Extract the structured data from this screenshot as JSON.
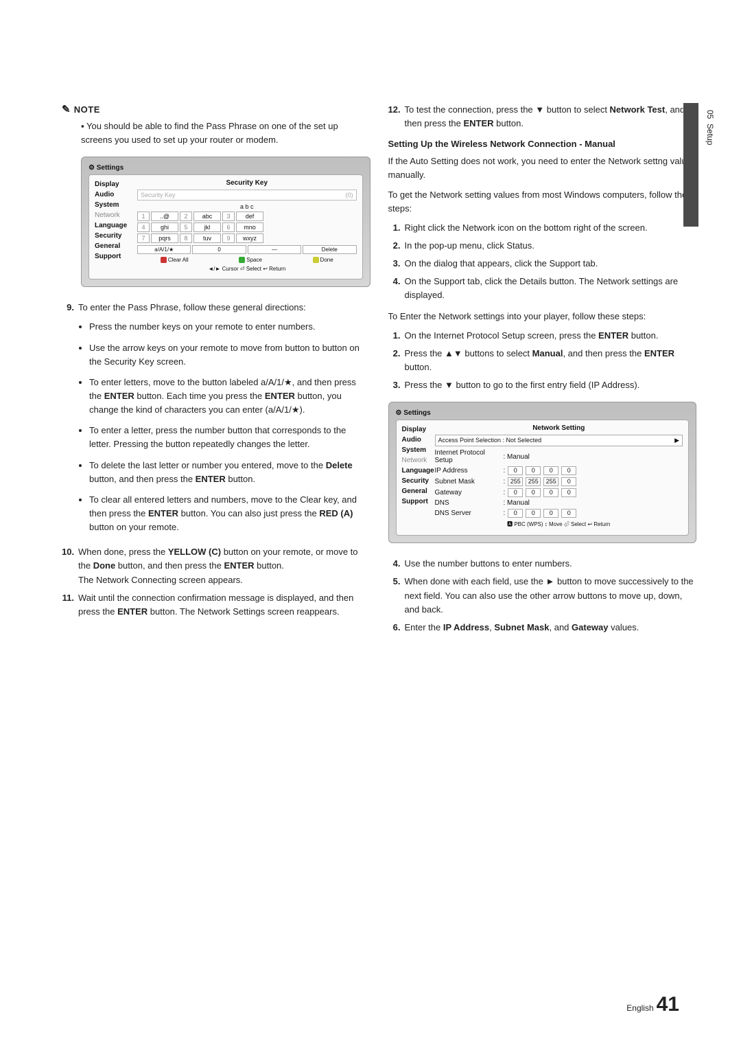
{
  "sideTab": {
    "chapter": "05",
    "title": "Setup"
  },
  "footer": {
    "lang": "English",
    "page": "41"
  },
  "left": {
    "noteLabel": "NOTE",
    "noteText": "You should be able to find the Pass Phrase on one of the set up screens you used to set up your router or modem.",
    "step9n": "9.",
    "step9": "To enter the Pass Phrase, follow these general directions:",
    "b1": "Press the number keys on your remote to enter numbers.",
    "b2": "Use the arrow keys on your remote to move from button to button on the Security Key screen.",
    "b3a": "To enter letters, move to the button labeled a/A/1/★, and then press the ",
    "b3b": " button. Each time you press the ",
    "b3c": " button, you change the kind of characters you can enter (a/A/1/★).",
    "b4": "To enter a letter, press the number button that corresponds to the letter. Pressing the button repeatedly changes the letter.",
    "b5a": "To delete the last letter or number you entered, move to the ",
    "b5b": " button, and then press the ",
    "b5c": " button.",
    "b6a": "To clear all entered letters and numbers, move to the Clear key, and then press the ",
    "b6b": " button. You can also just press the ",
    "b6c": " button on your remote.",
    "step10n": "10.",
    "step10a": "When done, press the ",
    "step10b": " button on your remote, or move to the ",
    "step10c": " button, and then press the ",
    "step10d": " button.",
    "step10e": "The Network Connecting screen appears.",
    "step11n": "11.",
    "step11a": "Wait until the connection confirmation message is displayed, and then press the ",
    "step11b": " button. The Network Settings screen reappears.",
    "enter": "ENTER",
    "delete": "Delete",
    "yellowc": "YELLOW (C)",
    "done": "Done",
    "reda": "RED (A)"
  },
  "right": {
    "step12n": "12.",
    "step12a": "To test the connection, press the ▼ button to select ",
    "step12nt": "Network Test",
    "step12b": ", and then press the ",
    "step12c": " button.",
    "heading": "Setting Up the Wireless Network Connection - Manual",
    "p1": "If the Auto Setting does not work, you need to enter the Network settng values manually.",
    "p2": "To get the Network setting values from most Windows computers, follow these steps:",
    "a1n": "1.",
    "a1": "Right click the Network icon on the bottom right of the screen.",
    "a2n": "2.",
    "a2": "In the pop-up menu, click Status.",
    "a3n": "3.",
    "a3": "On the dialog that appears, click the Support tab.",
    "a4n": "4.",
    "a4": "On the Support tab, click the Details button. The Network settings are displayed.",
    "p3": "To Enter the Network settings into your player, follow these steps:",
    "c1n": "1.",
    "c1a": "On the Internet Protocol Setup screen, press the ",
    "c1b": " button.",
    "c2n": "2.",
    "c2a": "Press the ▲▼ buttons to select ",
    "c2m": "Manual",
    "c2b": ", and then press the ",
    "c2c": " button.",
    "c3n": "3.",
    "c3": "Press the ▼ button to go to the first entry field (IP Address).",
    "c4n": "4.",
    "c4": "Use the number buttons to enter numbers.",
    "c5n": "5.",
    "c5": "When done with each field, use the ► button to move successively to the next field. You can also use the other arrow buttons to move up, down, and back.",
    "c6n": "6.",
    "c6a": "Enter the ",
    "c6ip": "IP Address",
    "c6s": ", ",
    "c6sm": "Subnet Mask",
    "c6a2": ", and ",
    "c6gw": "Gateway",
    "c6e": " values.",
    "enter": "ENTER"
  },
  "screen1": {
    "hdr": "Settings",
    "menu": [
      "Display",
      "Audio",
      "System",
      "Network",
      "Language",
      "Security",
      "General",
      "Support"
    ],
    "title": "Security Key",
    "placeholder": "Security Key",
    "count": "(0)",
    "abc": "a  b  c",
    "keys": [
      [
        "1",
        "..@"
      ],
      [
        "2",
        "abc"
      ],
      [
        "3",
        "def"
      ],
      [
        "4",
        "ghi"
      ],
      [
        "5",
        "jkl"
      ],
      [
        "6",
        "mno"
      ],
      [
        "7",
        "pqrs"
      ],
      [
        "8",
        "tuv"
      ],
      [
        "9",
        "wxyz"
      ]
    ],
    "bottom": [
      "a/A/1/★",
      "0",
      "—",
      "Delete"
    ],
    "clr": [
      "Clear All",
      "Space",
      "Done"
    ],
    "help": "◄/► Cursor   ⏎ Select   ↩ Return"
  },
  "screen2": {
    "hdr": "Settings",
    "menu": [
      "Display",
      "Audio",
      "System",
      "Network",
      "Language",
      "Security",
      "General",
      "Support"
    ],
    "title": "Network Setting",
    "apsLabel": "Access Point Selection  : Not Selected",
    "ipsLabel": "Internet Protocol Setup",
    "ipsVal": ": Manual",
    "ipLabel": "IP Address",
    "ip": [
      "0",
      "0",
      "0",
      "0"
    ],
    "smLabel": "Subnet Mask",
    "sm": [
      "255",
      "255",
      "255",
      "0"
    ],
    "gwLabel": "Gateway",
    "gw": [
      "0",
      "0",
      "0",
      "0"
    ],
    "dnsLabel": "DNS",
    "dnsVal": ": Manual",
    "dnssLabel": "DNS Server",
    "dnss": [
      "0",
      "0",
      "0",
      "0"
    ],
    "help": "🅰 PBC (WPS)   ↕ Move   ⏎ Select   ↩ Return"
  }
}
